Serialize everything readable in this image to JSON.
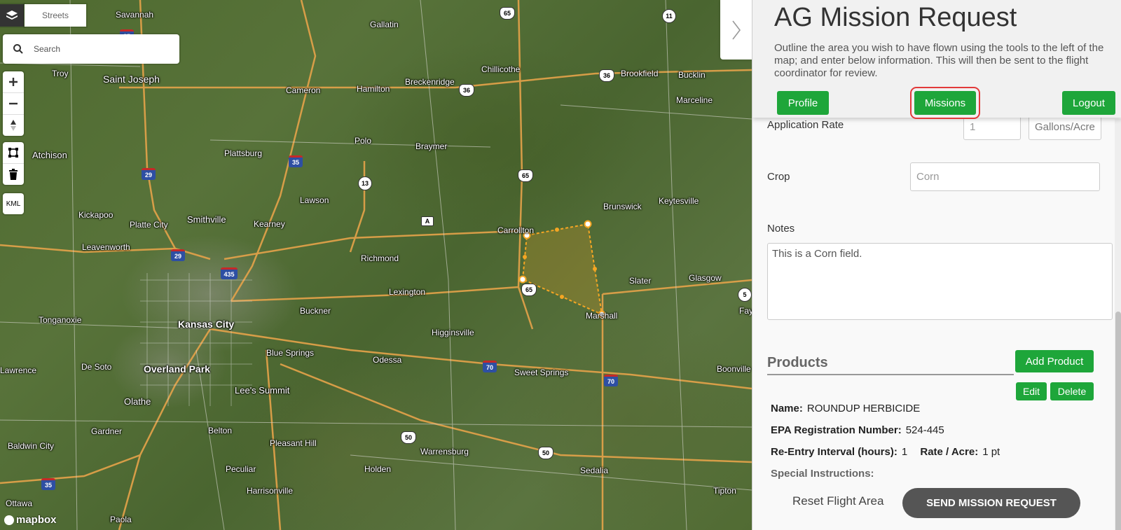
{
  "map": {
    "layer_switch_label": "Streets",
    "search_placeholder": "Search",
    "kml_label": "KML",
    "attribution": "mapbox",
    "places": [
      {
        "name": "Savannah"
      },
      {
        "name": "Gallatin"
      },
      {
        "name": "Troy"
      },
      {
        "name": "Saint Joseph"
      },
      {
        "name": "Cameron"
      },
      {
        "name": "Hamilton"
      },
      {
        "name": "Breckenridge"
      },
      {
        "name": "Chillicothe"
      },
      {
        "name": "Brookfield"
      },
      {
        "name": "Bucklin"
      },
      {
        "name": "Marceline"
      },
      {
        "name": "Atchison"
      },
      {
        "name": "Plattsburg"
      },
      {
        "name": "Polo"
      },
      {
        "name": "Braymer"
      },
      {
        "name": "Lawson"
      },
      {
        "name": "Kickapoo"
      },
      {
        "name": "Platte City"
      },
      {
        "name": "Smithville"
      },
      {
        "name": "Kearney"
      },
      {
        "name": "Carrollton"
      },
      {
        "name": "Brunswick"
      },
      {
        "name": "Keytesville"
      },
      {
        "name": "Leavenworth"
      },
      {
        "name": "Richmond"
      },
      {
        "name": "Slater"
      },
      {
        "name": "Glasgow"
      },
      {
        "name": "Lexington"
      },
      {
        "name": "Buckner"
      },
      {
        "name": "Marshall"
      },
      {
        "name": "Tonganoxie"
      },
      {
        "name": "Kansas City"
      },
      {
        "name": "Higginsville"
      },
      {
        "name": "Blue Springs"
      },
      {
        "name": "Odessa"
      },
      {
        "name": "Lawrence"
      },
      {
        "name": "De Soto"
      },
      {
        "name": "Overland Park"
      },
      {
        "name": "Lee's Summit"
      },
      {
        "name": "Sweet Springs"
      },
      {
        "name": "Boonville"
      },
      {
        "name": "Olathe"
      },
      {
        "name": "Gardner"
      },
      {
        "name": "Belton"
      },
      {
        "name": "Pleasant Hill"
      },
      {
        "name": "Baldwin City"
      },
      {
        "name": "Warrensburg"
      },
      {
        "name": "Peculiar"
      },
      {
        "name": "Holden"
      },
      {
        "name": "Sedalia"
      },
      {
        "name": "Harrisonville"
      },
      {
        "name": "Ottawa"
      },
      {
        "name": "Tipton"
      },
      {
        "name": "Paola"
      },
      {
        "name": "Fay"
      }
    ],
    "shields": [
      {
        "label": "35"
      },
      {
        "label": "65"
      },
      {
        "label": "11"
      },
      {
        "label": "36"
      },
      {
        "label": "36"
      },
      {
        "label": "29"
      },
      {
        "label": "35"
      },
      {
        "label": "13"
      },
      {
        "label": "65"
      },
      {
        "label": "A"
      },
      {
        "label": "29"
      },
      {
        "label": "435"
      },
      {
        "label": "65"
      },
      {
        "label": "5"
      },
      {
        "label": "70"
      },
      {
        "label": "70"
      },
      {
        "label": "50"
      },
      {
        "label": "50"
      },
      {
        "label": "35"
      }
    ]
  },
  "panel": {
    "title": "AG Mission Request",
    "description": "Outline the area you wish to have flown using the tools to the left of the map; and enter below information. This will then be sent to the flight coordinator for review.",
    "buttons": {
      "profile": "Profile",
      "missions": "Missions",
      "logout": "Logout"
    },
    "form": {
      "application_rate_label": "Application Rate",
      "application_rate_value": "1",
      "application_rate_unit": "Gallons/Acre",
      "crop_label": "Crop",
      "crop_value": "Corn",
      "notes_label": "Notes",
      "notes_value": "This is a Corn field."
    },
    "products": {
      "heading": "Products",
      "add_label": "Add Product",
      "edit_label": "Edit",
      "delete_label": "Delete",
      "name_label": "Name:",
      "name_value": "ROUNDUP HERBICIDE",
      "epa_label": "EPA Registration Number:",
      "epa_value": "524-445",
      "reentry_label": "Re-Entry Interval (hours):",
      "reentry_value": "1",
      "rate_label": "Rate / Acre:",
      "rate_value": "1 pt",
      "special_label": "Special Instructions:"
    },
    "reset_label": "Reset Flight Area",
    "send_label": "SEND MISSION REQUEST"
  },
  "colors": {
    "accent_green": "#1ea63a",
    "highlight_red": "#e23a3a",
    "polygon_orange": "#f5a623"
  }
}
